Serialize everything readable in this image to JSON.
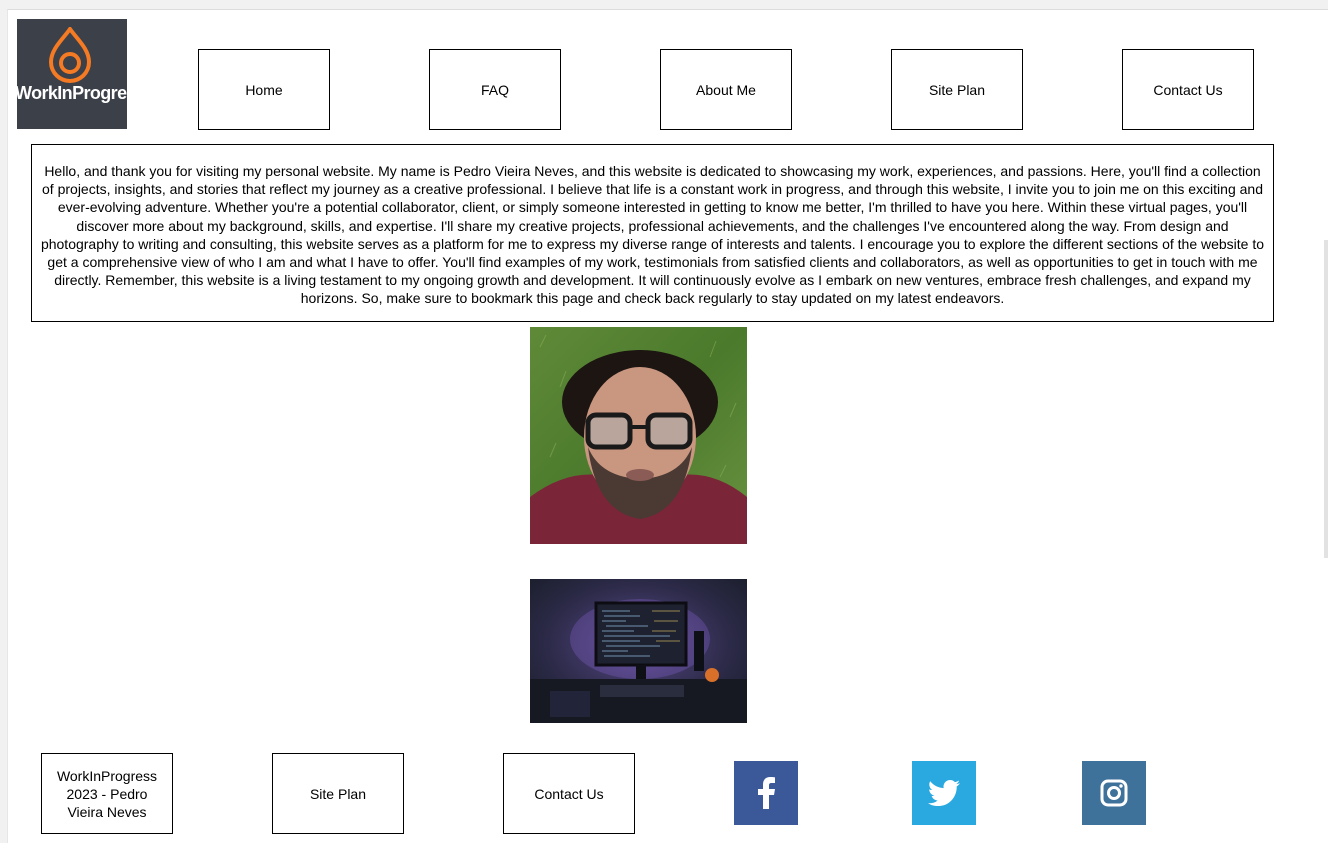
{
  "logo": {
    "text": "WorkInProgress",
    "accent": "#f47a24",
    "background": "#3c4048"
  },
  "nav": {
    "items": [
      "Home",
      "FAQ",
      "About Me",
      "Site Plan",
      "Contact Us"
    ]
  },
  "intro": {
    "text": "Hello, and thank you for visiting my personal website. My name is Pedro Vieira Neves, and this website is dedicated to showcasing my work, experiences, and passions. Here, you'll find a collection of projects, insights, and stories that reflect my journey as a creative professional. I believe that life is a constant work in progress, and through this website, I invite you to join me on this exciting and ever-evolving adventure. Whether you're a potential collaborator, client, or simply someone interested in getting to know me better, I'm thrilled to have you here. Within these virtual pages, you'll discover more about my background, skills, and expertise. I'll share my creative projects, professional achievements, and the challenges I've encountered along the way. From design and photography to writing and consulting, this website serves as a platform for me to express my diverse range of interests and talents. I encourage you to explore the different sections of the website to get a comprehensive view of who I am and what I have to offer. You'll find examples of my work, testimonials from satisfied clients and collaborators, as well as opportunities to get in touch with me directly. Remember, this website is a living testament to my ongoing growth and development. It will continuously evolve as I embark on new ventures, embrace fresh challenges, and expand my horizons. So, make sure to bookmark this page and check back regularly to stay updated on my latest endeavors."
  },
  "footer": {
    "copyright": "WorkInProgress 2023 - Pedro Vieira Neves",
    "site_plan": "Site Plan",
    "contact": "Contact Us",
    "social": [
      {
        "icon": "facebook-icon",
        "color": "#3b5998"
      },
      {
        "icon": "twitter-icon",
        "color": "#29a9e0"
      },
      {
        "icon": "instagram-icon",
        "color": "#3f729b"
      }
    ]
  }
}
